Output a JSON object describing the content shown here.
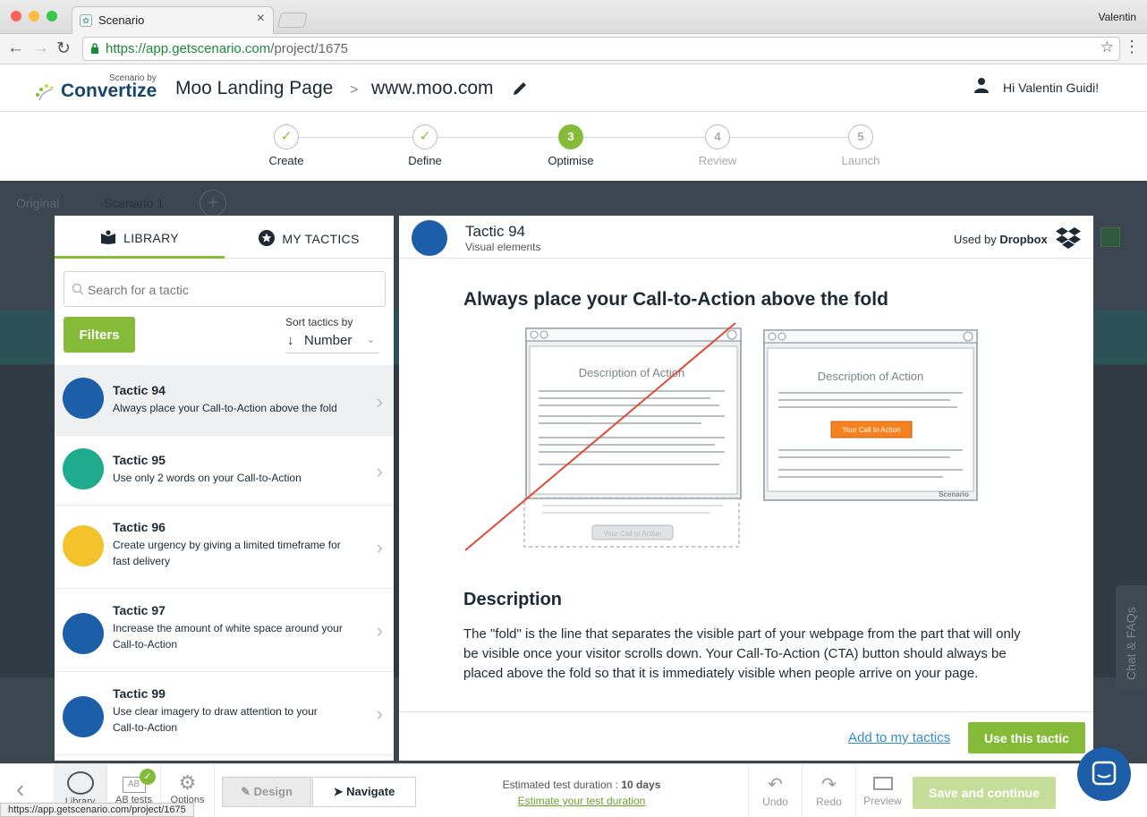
{
  "browser": {
    "tab_title": "Scenario",
    "user": "Valentin",
    "url_host": "https://app.getscenario.com",
    "url_path": "/project/1675",
    "status_url": "https://app.getscenario.com/project/1675"
  },
  "header": {
    "logo_small": "Scenario by",
    "logo_big": "Convertize",
    "project": "Moo Landing Page",
    "separator": ">",
    "site": "www.moo.com",
    "greeting": "Hi Valentin Guidi!"
  },
  "steps": [
    {
      "num": "✓",
      "label": "Create"
    },
    {
      "num": "✓",
      "label": "Define"
    },
    {
      "num": "3",
      "label": "Optimise"
    },
    {
      "num": "4",
      "label": "Review"
    },
    {
      "num": "5",
      "label": "Launch"
    }
  ],
  "background": {
    "tab1": "Original",
    "tab2": "Scenario 1",
    "chat": "Chat & FAQs"
  },
  "library": {
    "tab_library": "LIBRARY",
    "tab_mytactics": "MY TACTICS",
    "search_placeholder": "Search for a tactic",
    "filters": "Filters",
    "sort_label": "Sort tactics by",
    "sort_value": "Number",
    "tactics": [
      {
        "title": "Tactic 94",
        "desc": "Always place your Call-to-Action above the fold",
        "color": "#1d5ea9"
      },
      {
        "title": "Tactic 95",
        "desc": "Use only 2 words on your Call-to-Action",
        "color": "#1fac8e"
      },
      {
        "title": "Tactic 96",
        "desc": "Create urgency by giving a limited timeframe for fast delivery",
        "color": "#f4c22b"
      },
      {
        "title": "Tactic 97",
        "desc": "Increase the amount of white space around your Call-to-Action",
        "color": "#1d5ea9"
      },
      {
        "title": "Tactic 99",
        "desc": "Use clear imagery to draw attention to your Call-to-Action",
        "color": "#1d5ea9"
      }
    ]
  },
  "detail": {
    "title": "Tactic 94",
    "subtitle": "Visual elements",
    "used_by_label": "Used by",
    "used_by_brand": "Dropbox",
    "headline": "Always place your Call-to-Action above the fold",
    "illus_desc": "Description of Action",
    "illus_cta": "Your Call to Action",
    "illus_brand": "Scenario",
    "desc_title": "Description",
    "desc_text": "The \"fold\" is the line that separates the visible part of your webpage from the part that will only be visible once your visitor scrolls down. Your Call-To-Action (CTA) button should always be placed above the fold so that it is immediately visible when people arrive on your page.",
    "add_link": "Add to my tactics",
    "use_btn": "Use this tactic"
  },
  "toolbar": {
    "library": "Library",
    "ab_label": "AB",
    "abtests": "AB tests",
    "options": "Options",
    "design": "Design",
    "navigate": "Navigate",
    "est_label": "Estimated test duration :",
    "est_value": "10 days",
    "est_link": "Estimate your test duration",
    "undo": "Undo",
    "redo": "Redo",
    "preview": "Preview",
    "save": "Save and continue"
  },
  "colors": {
    "green": "#86bb3a",
    "blue": "#1d5ea9",
    "link": "#2f8ed3"
  }
}
